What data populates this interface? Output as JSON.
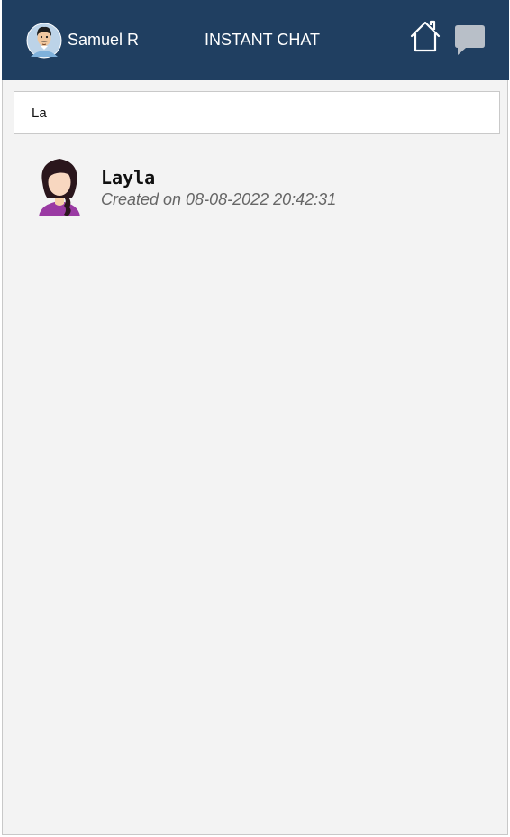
{
  "header": {
    "user_name": "Samuel R",
    "title": "INSTANT CHAT",
    "icons": [
      "user-avatar",
      "home-icon",
      "chat-icon"
    ],
    "background": "#203f61"
  },
  "search": {
    "value": "La"
  },
  "contacts": [
    {
      "name": "Layla",
      "created": "Created on 08-08-2022 20:42:31",
      "avatar": "female-avatar"
    }
  ],
  "colors": {
    "header_bg": "#203f61",
    "page_bg": "#f3f3f3",
    "chat_icon": "#b8bfc8"
  }
}
